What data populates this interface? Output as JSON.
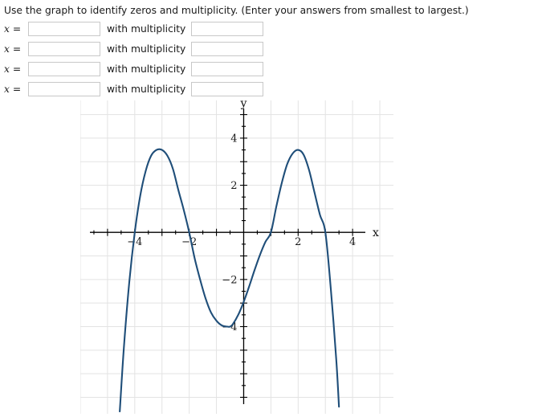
{
  "prompt": {
    "text": "Use the graph to identify zeros and multiplicity. (Enter your answers from smallest to largest.)"
  },
  "answers": {
    "rows": [
      {
        "x_label": "x =",
        "x_value": "",
        "x_placeholder": "",
        "mult_label": "with multiplicity",
        "mult_value": "",
        "mult_placeholder": ""
      },
      {
        "x_label": "x =",
        "x_value": "",
        "x_placeholder": "",
        "mult_label": "with multiplicity",
        "mult_value": "",
        "mult_placeholder": ""
      },
      {
        "x_label": "x =",
        "x_value": "",
        "x_placeholder": "",
        "mult_label": "with multiplicity",
        "mult_value": "",
        "mult_placeholder": ""
      },
      {
        "x_label": "x =",
        "x_value": "",
        "x_placeholder": "",
        "mult_label": "with multiplicity",
        "mult_value": "",
        "mult_placeholder": ""
      }
    ]
  },
  "chart_data": {
    "type": "line",
    "title": "",
    "xlabel": "x",
    "ylabel": "y",
    "xlim": [
      -6.0,
      5.5
    ],
    "ylim": [
      -7.7,
      5.6
    ],
    "grid": true,
    "grid_spacing": 1,
    "tick_spacing_minor": 0.5,
    "legend": "none",
    "curve_color": "#1f4e79",
    "grid_color": "#e3e3e3",
    "axis_color": "#000000",
    "x_ticks_labeled": [
      -4,
      -2,
      2,
      4
    ],
    "x_tick_labels": [
      "−4",
      "−2",
      "2",
      "4"
    ],
    "y_ticks_labeled": [
      -4,
      -2,
      2,
      4
    ],
    "y_tick_labels": [
      "−4",
      "−2",
      "2",
      "4"
    ],
    "zeros": [
      -4,
      -2,
      1,
      3
    ],
    "multiplicities": [
      1,
      1,
      1,
      1
    ],
    "local_maxima": [
      {
        "x": -3.0,
        "y": 3.5
      },
      {
        "x": 2.0,
        "y": 3.5
      }
    ],
    "local_minima": [
      {
        "x": -0.5,
        "y": -3.95
      }
    ],
    "description": "Quartic-like polynomial opening downward with four simple zeros",
    "x": [
      -4.55,
      -4.4,
      -4.2,
      -4.0,
      -3.8,
      -3.6,
      -3.4,
      -3.2,
      -3.0,
      -2.8,
      -2.6,
      -2.4,
      -2.2,
      -2.0,
      -1.8,
      -1.6,
      -1.4,
      -1.2,
      -1.0,
      -0.8,
      -0.6,
      -0.5,
      -0.4,
      -0.2,
      0.0,
      0.2,
      0.4,
      0.6,
      0.8,
      1.0,
      1.2,
      1.4,
      1.6,
      1.8,
      2.0,
      2.2,
      2.4,
      2.6,
      2.8,
      3.0,
      3.2,
      3.4,
      3.5
    ],
    "y": [
      -7.6,
      -4.9,
      -2.1,
      0.0,
      1.55,
      2.6,
      3.25,
      3.5,
      3.5,
      3.25,
      2.7,
      1.8,
      0.95,
      0.0,
      -1.1,
      -2.0,
      -2.8,
      -3.4,
      -3.75,
      -3.95,
      -4.0,
      -4.0,
      -3.9,
      -3.5,
      -2.95,
      -2.3,
      -1.6,
      -0.95,
      -0.4,
      0.0,
      1.1,
      2.1,
      2.9,
      3.35,
      3.5,
      3.3,
      2.65,
      1.7,
      0.75,
      0.0,
      -2.4,
      -5.4,
      -7.4
    ]
  }
}
